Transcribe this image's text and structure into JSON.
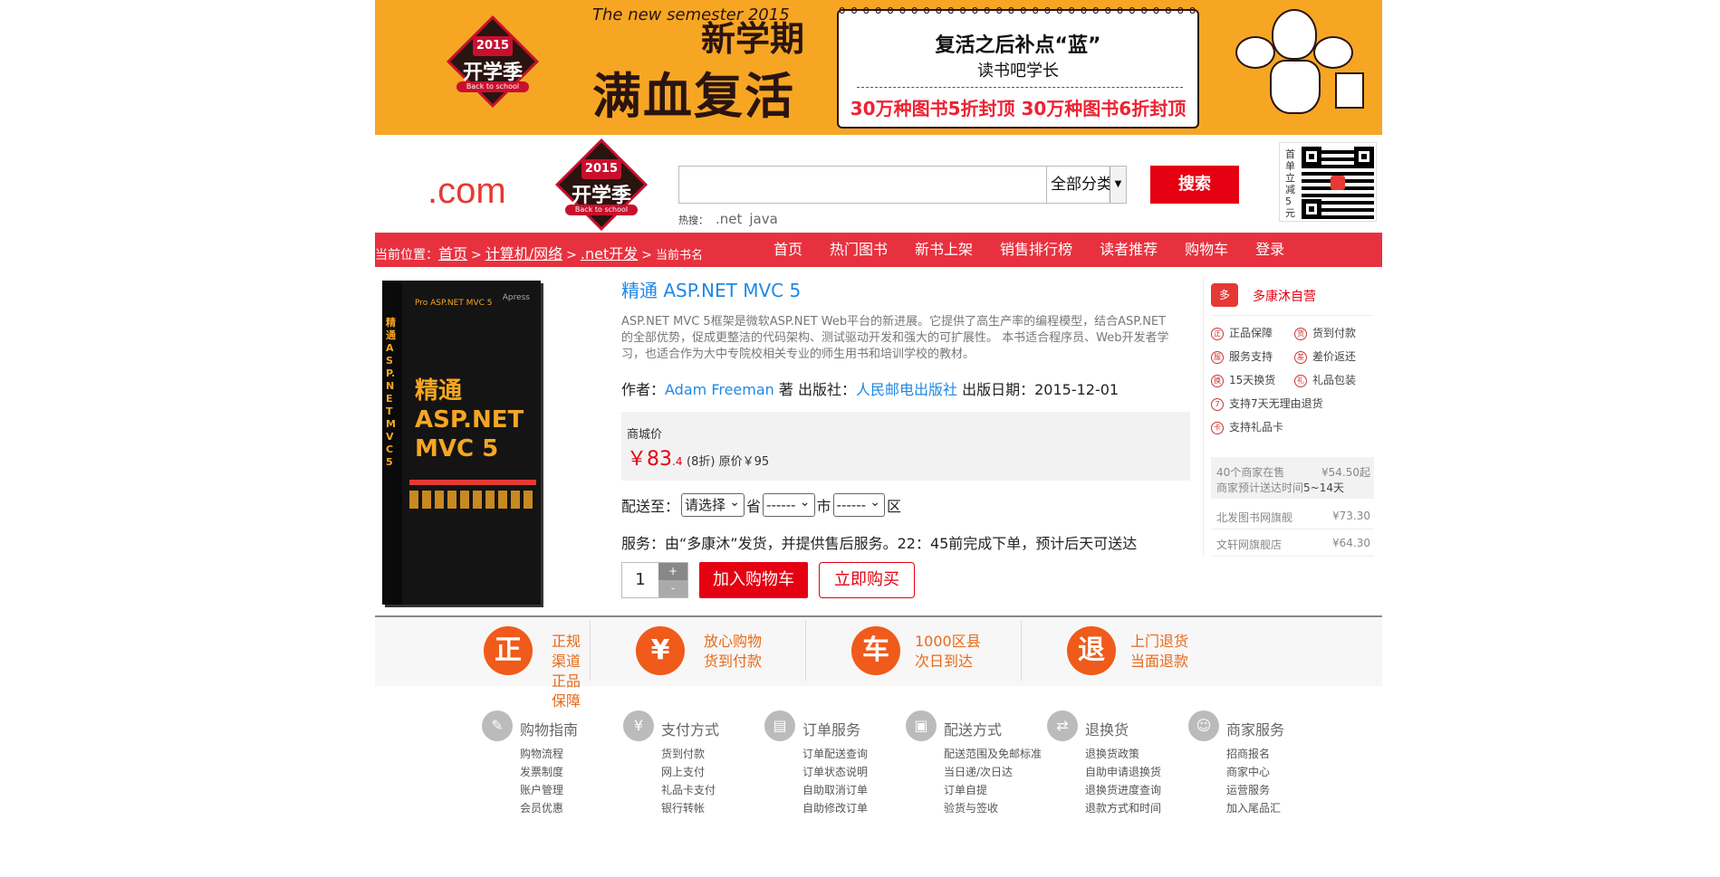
{
  "banner": {
    "badge_year": "2015",
    "badge_text": "开学季",
    "badge_sub": "Back to school",
    "semester_en": "The new semester",
    "semester_year": "2015",
    "semester_cn": "新学期",
    "headline": "满血复活",
    "note_title": "复活之后补点“蓝”",
    "note_sub": "读书吧学长",
    "note_promo": "30万种图书5折封顶  30万种图书6折封顶"
  },
  "header": {
    "logo": ".com",
    "badge_year": "2015",
    "badge_text": "开学季",
    "badge_sub": "Back to school",
    "search_placeholder": "",
    "category": "全部分类",
    "search_button": "搜索",
    "hot_label": "热搜：",
    "hot_words": [
      ".net",
      "java"
    ],
    "qr_text": "首单立减5元"
  },
  "nav": {
    "crumb_label": "当前位置：",
    "crumbs": [
      "首页",
      "计算机/网络",
      ".net开发"
    ],
    "current": "当前书名",
    "items": [
      "首页",
      "热门图书",
      "新书上架",
      "销售排行榜",
      "读者推荐",
      "购物车",
      "登录"
    ]
  },
  "product": {
    "cover_publisher": "Apress",
    "cover_pro": "Pro ASP.NET MVC 5",
    "cover_title": "精通 ASP.NET MVC 5",
    "title": "精通 ASP.NET MVC 5",
    "description": "ASP.NET MVC 5框架是微软ASP.NET Web平台的新进展。它提供了高生产率的编程模型，结合ASP.NET的全部优势，促成更整洁的代码架构、测试驱动开发和强大的可扩展性。 本书适合程序员、Web开发者学习，也适合作为大中专院校相关专业的师生用书和培训学校的教材。",
    "author_label": "作者：",
    "author": "Adam Freeman",
    "author_suffix": " 著 出版社：",
    "publisher": "人民邮电出版社",
    "date_label": " 出版日期：",
    "date": "2015-12-01",
    "price_label": "商城价",
    "price_symbol": "￥",
    "price_main": "83",
    "price_decimal": ".4",
    "discount": "(8折)",
    "orig_price": "原价￥95",
    "ship_label": "配送至：",
    "province": "请选择",
    "province_unit": "省",
    "city": "------",
    "city_unit": "市",
    "district": "------",
    "district_unit": "区",
    "service": "服务：由“多康沐”发货，并提供售后服务。22：45前完成下单，预计后天可送达",
    "quantity": "1",
    "plus": "+",
    "minus": "-",
    "add_to_cart": "加入购物车",
    "buy_now": "立即购买"
  },
  "store": {
    "logo": "多",
    "name": "多康沐自营",
    "tags": [
      {
        "icon": "正",
        "text": "正品保障"
      },
      {
        "icon": "货",
        "text": "货到付款"
      },
      {
        "icon": "服",
        "text": "服务支持"
      },
      {
        "icon": "差",
        "text": "差价返还"
      },
      {
        "icon": "换",
        "text": "15天换货"
      },
      {
        "icon": "礼",
        "text": "礼品包装"
      },
      {
        "icon": "7",
        "text": "支持7天无理由退货"
      },
      {
        "icon": "卡",
        "text": "支持礼品卡"
      }
    ],
    "sellers_summary": "40个商家在售",
    "sellers_from": "¥54.50起",
    "sellers_eta_label": "商家预计送达时间",
    "sellers_eta": "5~14天",
    "sellers": [
      {
        "name": "北发图书网旗舰",
        "price": "¥73.30"
      },
      {
        "name": "文轩网旗舰店",
        "price": "¥64.30"
      }
    ]
  },
  "guarantees": [
    {
      "icon": "正",
      "line1": "正规渠道",
      "line2": "正品保障"
    },
    {
      "icon": "¥",
      "line1": "放心购物",
      "line2": "货到付款"
    },
    {
      "icon": "车",
      "line1": "1000区县",
      "line2": "次日到达"
    },
    {
      "icon": "退",
      "line1": "上门退货",
      "line2": "当面退款"
    }
  ],
  "footer": [
    {
      "icon": "✎",
      "title": "购物指南",
      "links": [
        "购物流程",
        "发票制度",
        "账户管理",
        "会员优惠"
      ]
    },
    {
      "icon": "¥",
      "title": "支付方式",
      "links": [
        "货到付款",
        "网上支付",
        "礼品卡支付",
        "银行转帐"
      ]
    },
    {
      "icon": "▤",
      "title": "订单服务",
      "links": [
        "订单配送查询",
        "订单状态说明",
        "自助取消订单",
        "自助修改订单"
      ]
    },
    {
      "icon": "▣",
      "title": "配送方式",
      "links": [
        "配送范围及免邮标准",
        "当日递/次日达",
        "订单自提",
        "验货与签收"
      ]
    },
    {
      "icon": "⇄",
      "title": "退换货",
      "links": [
        "退换货政策",
        "自助申请退换货",
        "退换货进度查询",
        "退款方式和时间"
      ]
    },
    {
      "icon": "☺",
      "title": "商家服务",
      "links": [
        "招商报名",
        "商家中心",
        "运营服务",
        "加入尾品汇"
      ]
    }
  ],
  "colors": {
    "accent": "#e50012",
    "nav": "#e8313f",
    "banner": "#f6a623",
    "link": "#1e88e5",
    "guarantee": "#f05a1a"
  }
}
